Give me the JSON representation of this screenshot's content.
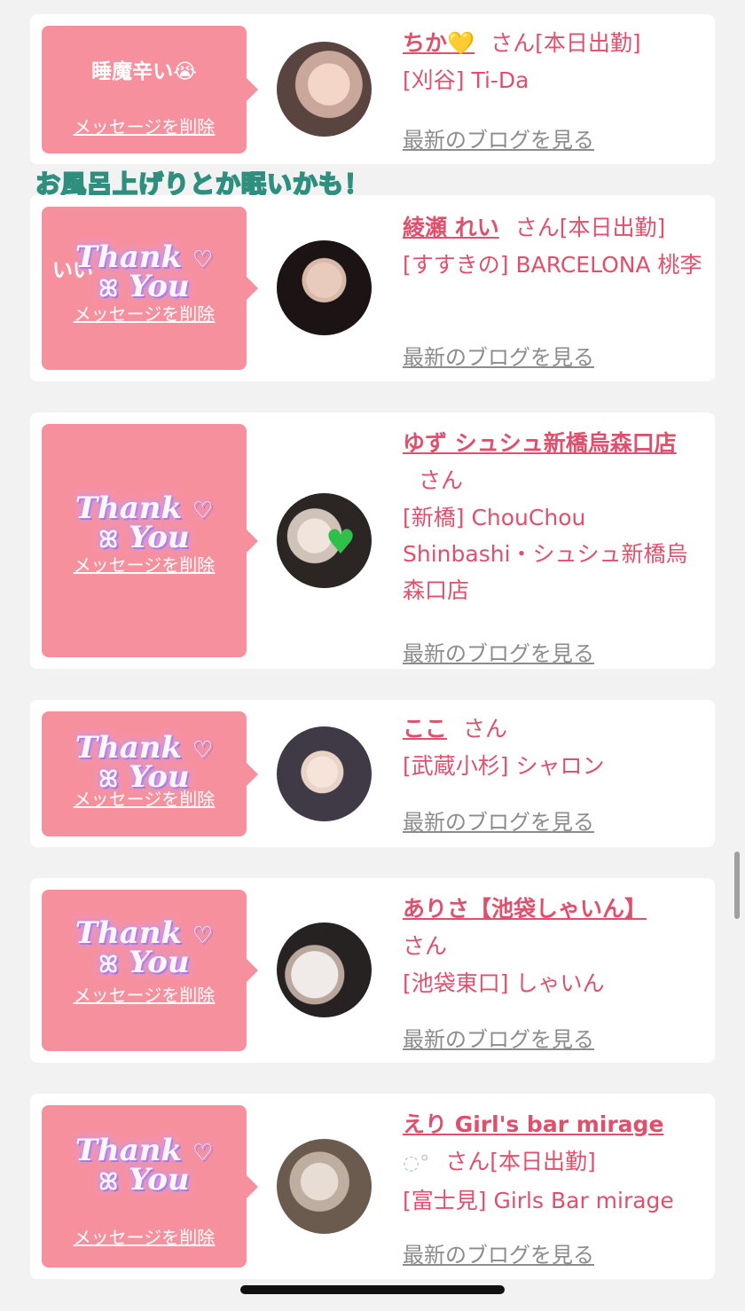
{
  "overlay_caption": "お風呂上げりとか眠いかも！",
  "delete_label": "メッセージを削除",
  "blog_label": "最新のブログを見る",
  "sticker": {
    "line1": "Thank",
    "line2": "You"
  },
  "entries": [
    {
      "message": "睡魔辛い😭",
      "name": "ちか💛",
      "suffix": "さん[本日出勤]",
      "shop": "[刈谷] Ti-Da",
      "sticker": false,
      "avatar_colors": [
        "#c9a79a",
        "#5a4440"
      ]
    },
    {
      "message": "いい",
      "name": "綾瀬 れい",
      "suffix": "さん[本日出勤]",
      "shop": "[すすきの] BARCELONA 桃李",
      "sticker": true,
      "avatar_colors": [
        "#d8b9a8",
        "#1c1414"
      ]
    },
    {
      "message": "",
      "name": "ゆず シュシュ新橋烏森口店",
      "suffix": "さん",
      "shop": "[新橋] ChouChou Shinbashi・シュシュ新橋烏森口店",
      "sticker": true,
      "avatar_colors": [
        "#cfc2b8",
        "#2b2624"
      ]
    },
    {
      "message": "",
      "name": "ここ",
      "suffix": "さん",
      "shop": "[武蔵小杉] シャロン",
      "sticker": true,
      "avatar_colors": [
        "#e9d3c7",
        "#3f3a46"
      ]
    },
    {
      "message": "",
      "name": "ありさ【池袋しゃいん】",
      "suffix": "さん",
      "shop": "[池袋東口] しゃいん",
      "sticker": true,
      "avatar_colors": [
        "#f0ebe8",
        "#262222"
      ]
    },
    {
      "message": "",
      "name": "えり Girl's bar mirage",
      "suffix": "さん[本日出勤]",
      "shop": "[富士見] Girls Bar mirage",
      "sticker": true,
      "avatar_colors": [
        "#bdaea0",
        "#6b5a4e"
      ]
    }
  ],
  "colors": {
    "accent": "#e0506c",
    "bubble": "#f7909d",
    "link_gray": "#8c8c8c"
  }
}
